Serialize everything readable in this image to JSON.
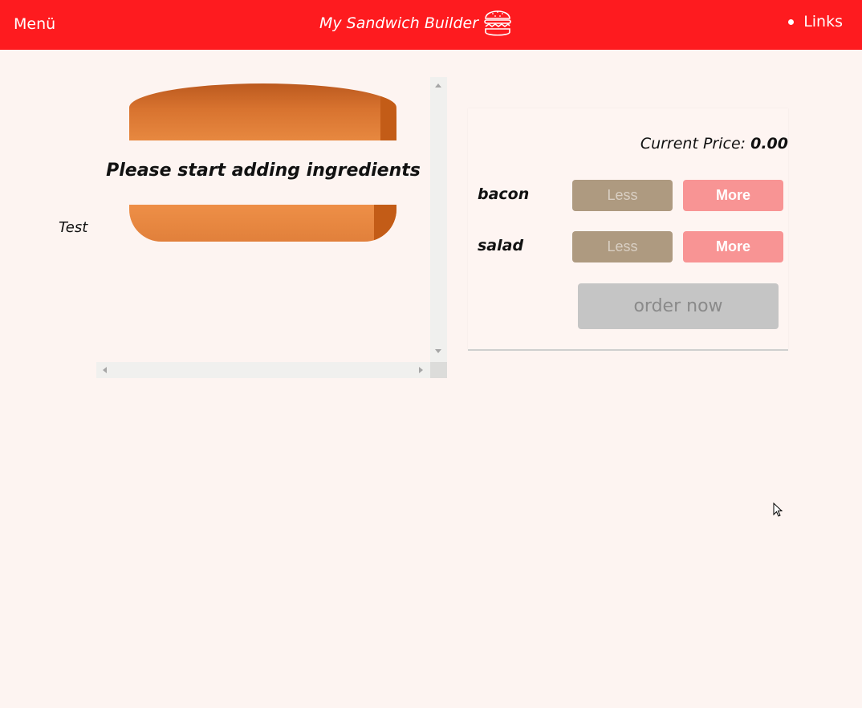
{
  "header": {
    "menu_label": "Menü",
    "title": "My Sandwich Builder",
    "logo_icon": "burger-icon",
    "links_label": "Links",
    "background_color": "#fe1b1f"
  },
  "side_label": "Test",
  "builder": {
    "empty_message": "Please start adding ingredients"
  },
  "controls": {
    "price_label": "Current Price:",
    "price_value": "0.00",
    "ingredients": [
      {
        "name": "bacon",
        "less_label": "Less",
        "more_label": "More"
      },
      {
        "name": "salad",
        "less_label": "Less",
        "more_label": "More"
      }
    ],
    "order_label": "order now"
  },
  "colors": {
    "background": "#fdf4f1",
    "less_button": "#ae9a80",
    "more_button": "#f89494",
    "order_button_disabled": "#c5c5c5",
    "bun": "#e1803b"
  }
}
